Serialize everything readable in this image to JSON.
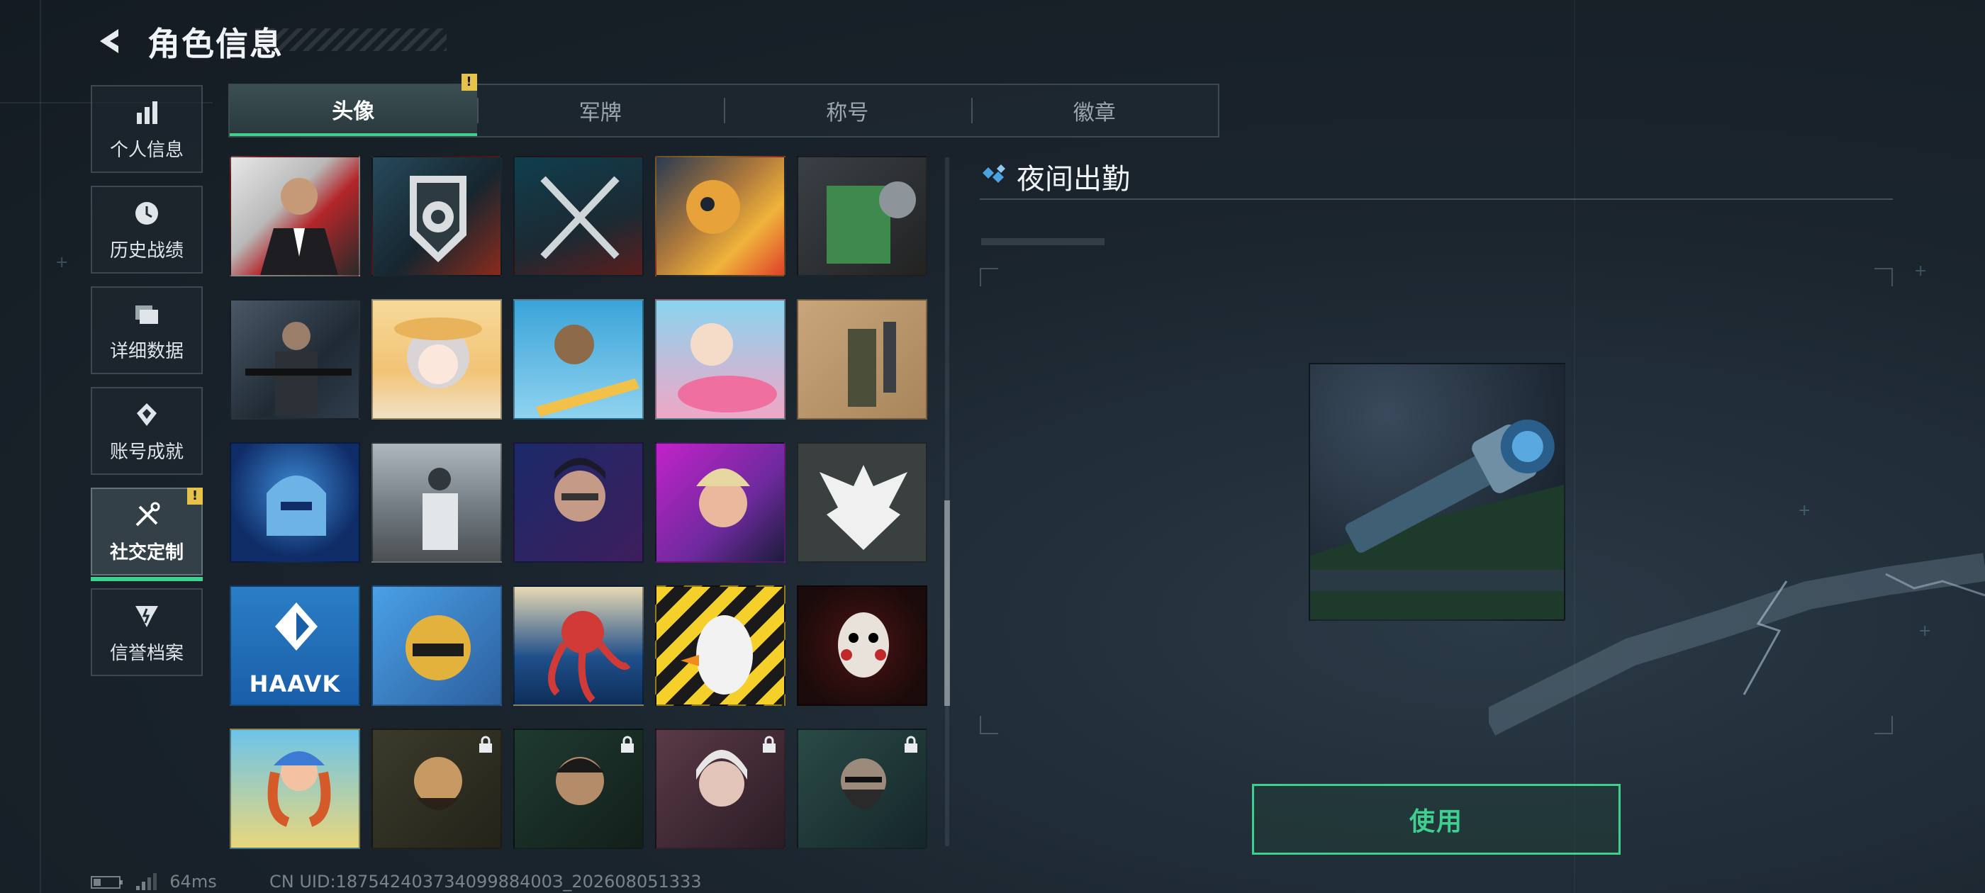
{
  "header": {
    "title": "角色信息"
  },
  "sidebar": {
    "items": [
      {
        "label": "个人信息",
        "icon": "bar-chart-icon"
      },
      {
        "label": "历史战绩",
        "icon": "history-icon"
      },
      {
        "label": "详细数据",
        "icon": "folder-icon"
      },
      {
        "label": "账号成就",
        "icon": "achievement-icon"
      },
      {
        "label": "社交定制",
        "icon": "tools-icon",
        "active": true,
        "badge": "!"
      },
      {
        "label": "信誉档案",
        "icon": "reputation-icon"
      }
    ]
  },
  "tabs": [
    {
      "label": "头像",
      "active": true
    },
    {
      "label": "军牌",
      "badge": "!"
    },
    {
      "label": "称号"
    },
    {
      "label": "徽章"
    }
  ],
  "avatars": [
    {
      "locked": false
    },
    {
      "locked": false
    },
    {
      "locked": false
    },
    {
      "locked": false
    },
    {
      "locked": false
    },
    {
      "locked": false
    },
    {
      "locked": false
    },
    {
      "locked": false
    },
    {
      "locked": false
    },
    {
      "locked": false
    },
    {
      "locked": false
    },
    {
      "locked": false
    },
    {
      "locked": false
    },
    {
      "locked": false
    },
    {
      "locked": false
    },
    {
      "locked": false,
      "text": "HAAVK"
    },
    {
      "locked": false
    },
    {
      "locked": false
    },
    {
      "locked": false
    },
    {
      "locked": false
    },
    {
      "locked": false
    },
    {
      "locked": true
    },
    {
      "locked": true
    },
    {
      "locked": true
    },
    {
      "locked": true
    }
  ],
  "detail": {
    "title": "夜间出勤",
    "action_label": "使用"
  },
  "status": {
    "ping": "64ms",
    "uid": "CN UID:18754240373409988400З_202608051333"
  },
  "colors": {
    "accent": "#3fcf8e",
    "warning": "#e7c24a",
    "diamond": "#4aa3e0"
  }
}
